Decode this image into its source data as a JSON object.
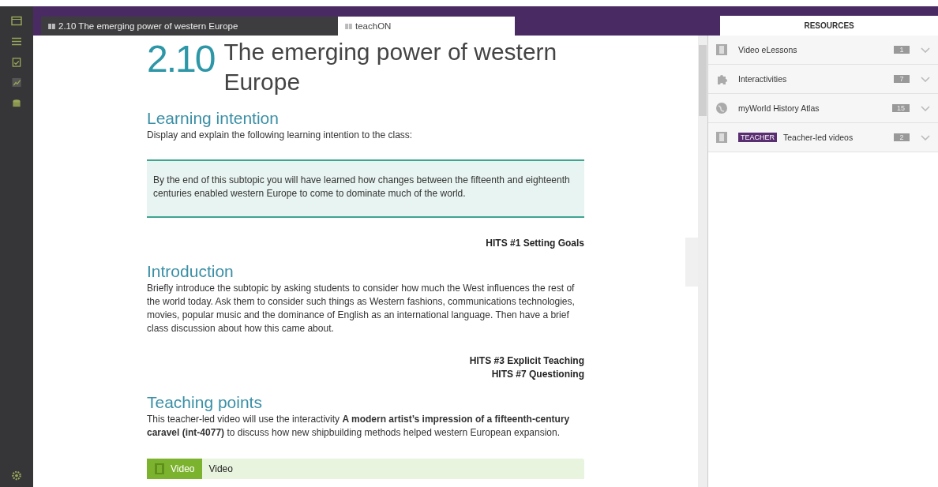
{
  "tabs": [
    {
      "label": "2.10 The emerging power of western Europe",
      "selected": false
    },
    {
      "label": "teachON",
      "selected": true
    }
  ],
  "lesson": {
    "number": "2.10",
    "title": "The emerging power of western Europe"
  },
  "sections": [
    {
      "heading": "Learning intention",
      "text": "Display and explain the following learning intention to the class:",
      "callout": "By the end of this subtopic you will have learned how changes between the fifteenth and eighteenth centuries enabled western Europe to come to dominate much of the world.",
      "hits": [
        "HITS #1 Setting Goals"
      ]
    },
    {
      "heading": "Introduction",
      "text": "Briefly introduce the subtopic by asking students to consider how much the West influences the rest of the world today. Ask them to consider such things as Western fashions, communications technologies, movies, popular music and the dominance of English as an international language. Then have a brief class discussion about how this came about.",
      "hits": [
        "HITS #3 Explicit Teaching",
        "HITS #7 Questioning"
      ]
    },
    {
      "heading": "Teaching points",
      "text": "This teacher-led video will use the interactivity **A modern artist’s impression of a fifteenth-century caravel (int-4077)** to discuss how new shipbuilding methods helped western European expansion."
    }
  ],
  "media_bar": {
    "tag": "Video",
    "label": "Video"
  },
  "resources": {
    "title": "RESOURCES",
    "items": [
      {
        "kind": "film",
        "label": "Video eLessons",
        "count": "1"
      },
      {
        "kind": "puzzle",
        "label": "Interactivities",
        "count": "7"
      },
      {
        "kind": "globe",
        "label": "myWorld History Atlas",
        "count": "15"
      },
      {
        "kind": "film",
        "badge": "TEACHER",
        "label": "Teacher-led videos",
        "count": "2"
      }
    ]
  }
}
